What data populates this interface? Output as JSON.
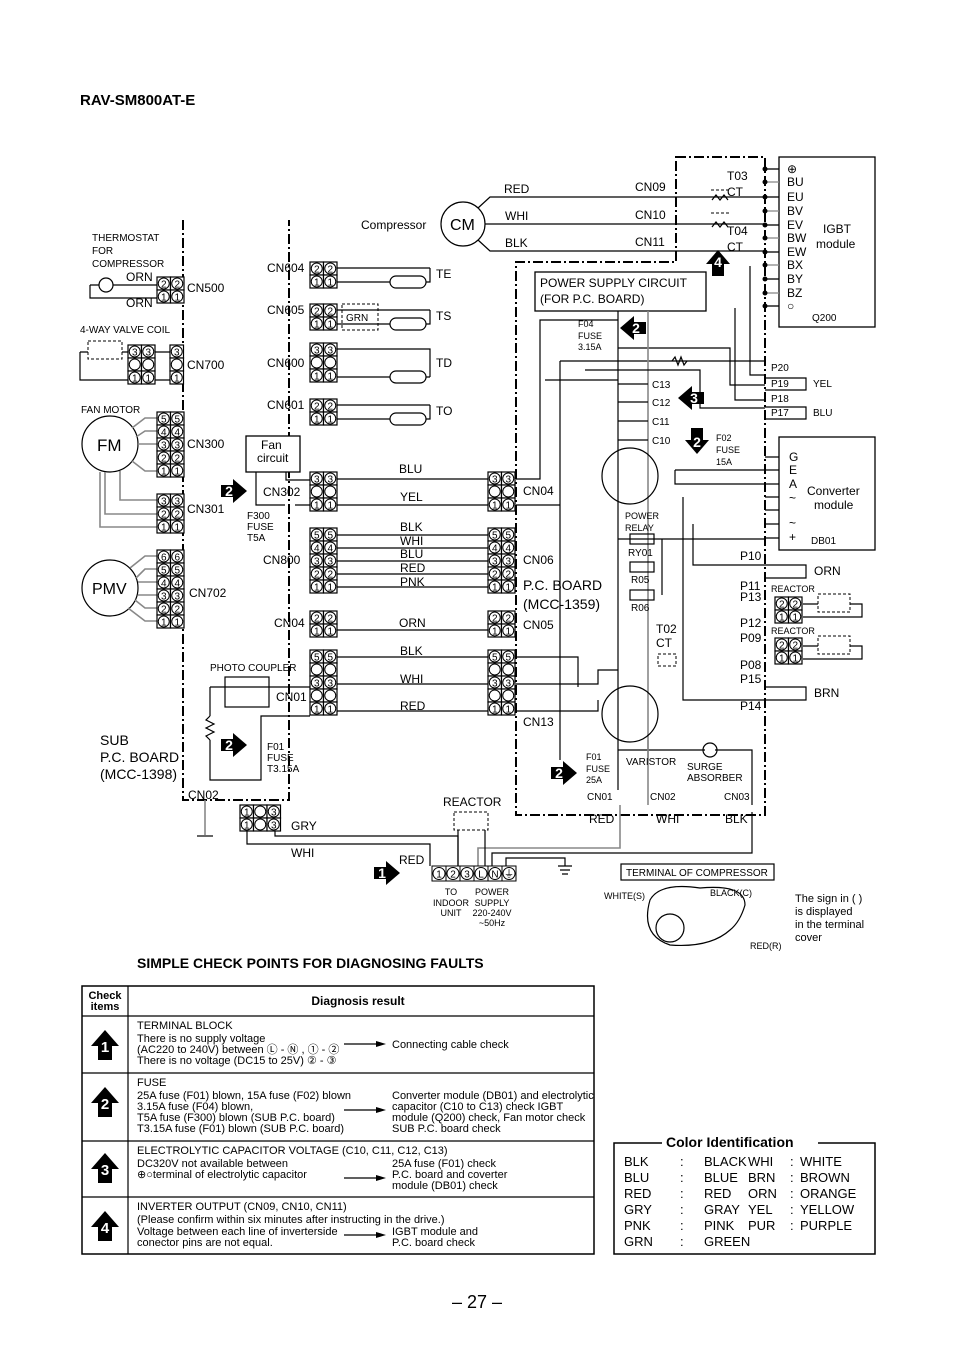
{
  "title": "RAV-SM800AT-E",
  "page_number": "– 27 –",
  "markers": {
    "one": "1",
    "two": "2",
    "three": "3",
    "four": "4"
  },
  "diagram": {
    "compressor": "Compressor",
    "cm": "CM",
    "red": "RED",
    "whi": "WHI",
    "blk": "BLK",
    "blu": "BLU",
    "yel": "YEL",
    "orn": "ORN",
    "pnk": "PNK",
    "grn": "GRN",
    "gry": "GRY",
    "brn": "BRN",
    "cn09": "CN09",
    "cn10": "CN10",
    "cn11": "CN11",
    "t03": "T03",
    "t04": "T04",
    "ct": "CT",
    "t02": "T02",
    "igbt_pins": [
      "⊕",
      "BU",
      "EU",
      "BV",
      "EV",
      "BW",
      "EW",
      "BX",
      "BY",
      "BZ",
      "○"
    ],
    "igbt_title": "IGBT",
    "igbt_sub": "module",
    "q200": "Q200",
    "psc_line1": "POWER SUPPLY CIRCUIT",
    "psc_line2": "(FOR P.C. BOARD)",
    "f04": "F04",
    "fuse": "FUSE",
    "f04_rating": "3.15A",
    "p20": "P20",
    "p19": "P19",
    "p18": "P18",
    "p17": "P17",
    "c13": "C13",
    "c12": "C12",
    "c11": "C11",
    "c10": "C10",
    "f02": "F02",
    "f02_rating": "15A",
    "conv_pins": [
      "G",
      "E",
      "A",
      "~",
      "~",
      "+"
    ],
    "conv_title": "Converter",
    "conv_sub": "module",
    "db01": "DB01",
    "power_relay_1": "POWER",
    "power_relay_2": "RELAY",
    "ry01": "RY01",
    "r05": "R05",
    "r06": "R06",
    "p10": "P10",
    "p11": "P11",
    "p13": "P13",
    "p12": "P12",
    "p09": "P09",
    "p08": "P08",
    "p15": "P15",
    "p14": "P14",
    "reactor": "REACTOR",
    "pcb_line1": "P.C. BOARD",
    "pcb_line2": "(MCC-1359)",
    "cn04": "CN04",
    "cn06": "CN06",
    "cn05": "CN05",
    "cn13": "CN13",
    "f01": "F01",
    "f01_rating": "25A",
    "varistor": "VARISTOR",
    "surge_1": "SURGE",
    "surge_2": "ABSORBER",
    "cn01": "CN01",
    "cn02": "CN02",
    "cn03": "CN03",
    "cn604": "CN604",
    "cn605": "CN605",
    "cn600": "CN600",
    "cn601": "CN601",
    "cn302": "CN302",
    "cn800": "CN800",
    "te": "TE",
    "ts": "TS",
    "td": "TD",
    "to": "TO",
    "fan_circuit_1": "Fan",
    "fan_circuit_2": "circuit",
    "f300": "F300",
    "f300_rating": "T5A",
    "thermostat_1": "THERMOSTAT",
    "thermostat_2": "FOR",
    "thermostat_3": "COMPRESSOR",
    "cn500": "CN500",
    "valve_coil": "4-WAY VALVE COIL",
    "cn700": "CN700",
    "fan_motor": "FAN MOTOR",
    "fm": "FM",
    "cn300": "CN300",
    "cn301": "CN301",
    "pmv": "PMV",
    "cn702": "CN702",
    "photo_coupler": "PHOTO COUPLER",
    "sub_f01": "F01",
    "sub_f01_rating": "T3.15A",
    "sub_pcb_1": "SUB",
    "sub_pcb_2": "P.C. BOARD",
    "sub_pcb_3": "(MCC-1398)",
    "terminal_pins": [
      "1",
      "2",
      "3",
      "L",
      "N",
      "⏚"
    ],
    "to_indoor": [
      "TO",
      "INDOOR",
      "UNIT"
    ],
    "power_supply": [
      "POWER",
      "SUPPLY",
      "220-240V",
      "~50Hz"
    ],
    "terminal_of_compressor": "TERMINAL OF COMPRESSOR",
    "white_s": "WHITE(S)",
    "black_c": "BLACK(C)",
    "red_r": "RED(R)",
    "sign_note": [
      "The sign in ( )",
      "is displayed",
      "in the  terminal",
      "cover"
    ]
  },
  "connectors": {
    "CN604": [
      [
        "2",
        "2"
      ],
      [
        "1",
        "1"
      ]
    ],
    "CN605": [
      [
        "2",
        "2"
      ],
      [
        "1",
        "1"
      ]
    ],
    "CN600": [
      [
        "3",
        "3"
      ],
      [
        "",
        ""
      ],
      [
        "1",
        "1"
      ]
    ],
    "CN601": [
      [
        "2",
        "2"
      ],
      [
        "1",
        "1"
      ]
    ],
    "CN302": [
      [
        "3",
        "3"
      ],
      [
        "",
        ""
      ],
      [
        "1",
        "1"
      ]
    ],
    "CN800": [
      [
        "5",
        "5"
      ],
      [
        "4",
        "4"
      ],
      [
        "3",
        "3"
      ],
      [
        "2",
        "2"
      ],
      [
        "1",
        "1"
      ]
    ],
    "CN04S": [
      [
        "2",
        "2"
      ],
      [
        "1",
        "1"
      ]
    ],
    "CN01S": [
      [
        "5",
        "5"
      ],
      [
        "",
        ""
      ],
      [
        "3",
        "3"
      ],
      [
        "",
        ""
      ],
      [
        "1",
        "1"
      ]
    ],
    "CN500": [
      [
        "2",
        "2"
      ],
      [
        "1",
        "1"
      ]
    ],
    "CN700A": [
      [
        "3",
        "3"
      ],
      [
        "",
        ""
      ],
      [
        "1",
        "1"
      ]
    ],
    "CN700B": [
      [
        "3"
      ],
      [
        ""
      ],
      [
        "1"
      ]
    ],
    "CN300": [
      [
        "5",
        "5"
      ],
      [
        "4",
        "4"
      ],
      [
        "3",
        "3"
      ],
      [
        "2",
        "2"
      ],
      [
        "1",
        "1"
      ]
    ],
    "CN301": [
      [
        "3",
        "3"
      ],
      [
        "2",
        "2"
      ],
      [
        "1",
        "1"
      ]
    ],
    "CN702": [
      [
        "6",
        "6"
      ],
      [
        "5",
        "5"
      ],
      [
        "4",
        "4"
      ],
      [
        "3",
        "3"
      ],
      [
        "2",
        "2"
      ],
      [
        "1",
        "1"
      ]
    ],
    "CN04M": [
      [
        "3",
        "3"
      ],
      [
        "",
        ""
      ],
      [
        "1",
        "1"
      ]
    ],
    "CN06": [
      [
        "5",
        "5"
      ],
      [
        "4",
        "4"
      ],
      [
        "3",
        "3"
      ],
      [
        "2",
        "2"
      ],
      [
        "1",
        "1"
      ]
    ],
    "CN05": [
      [
        "2",
        "2"
      ],
      [
        "1",
        "1"
      ]
    ],
    "CN13": [
      [
        "5",
        "5"
      ],
      [
        "",
        ""
      ],
      [
        "3",
        "3"
      ],
      [
        "",
        ""
      ],
      [
        "1",
        "1"
      ]
    ],
    "CN02S": [
      [
        "1",
        "",
        "3"
      ],
      [
        "1",
        "",
        "3"
      ]
    ],
    "REACT1": [
      [
        "2",
        "2"
      ],
      [
        "1",
        "1"
      ]
    ],
    "REACT2": [
      [
        "2",
        "2"
      ],
      [
        "1",
        "1"
      ]
    ]
  },
  "section_title": "SIMPLE CHECK POINTS FOR DIAGNOSING FAULTS",
  "table": {
    "header_check": [
      "Check",
      "items"
    ],
    "header_result": "Diagnosis result",
    "rows": [
      {
        "marker": "1",
        "heading": "TERMINAL BLOCK",
        "left": [
          "There is no supply voltage",
          "(AC220 to 240V) between Ⓛ - Ⓝ , ① - ②",
          "There is no voltage (DC15 to 25V) ② - ③"
        ],
        "right": [
          "Connecting cable check"
        ]
      },
      {
        "marker": "2",
        "heading": "FUSE",
        "left": [
          "25A fuse (F01) blown, 15A fuse (F02) blown",
          "3.15A fuse (F04) blown,",
          "T5A fuse (F300) blown (SUB P.C. board)",
          "T3.15A fuse (F01) blown (SUB P.C. board)"
        ],
        "right": [
          "Converter module (DB01) and electrolytic",
          "capacitor (C10 to C13) check  IGBT",
          "module (Q200) check, Fan motor check",
          "SUB P.C. board check"
        ]
      },
      {
        "marker": "3",
        "heading": "ELECTROLYTIC CAPACITOR VOLTAGE (C10, C11, C12, C13)",
        "left": [
          "DC320V not available between",
          "⊕○terminal of electrolytic capacitor"
        ],
        "right": [
          "25A fuse (F01) check",
          "P.C. board and coverter",
          "module (DB01) check"
        ]
      },
      {
        "marker": "4",
        "heading": "INVERTER OUTPUT (CN09, CN10, CN11)",
        "note": "(Please confirm within six minutes after instructing in the drive.)",
        "left": [
          "Voltage between each line of inverterside",
          "conector pins are not equal."
        ],
        "right": [
          "IGBT module and",
          "P.C. board check"
        ]
      }
    ]
  },
  "color_identification": {
    "title": "Color Identification",
    "left": [
      [
        "BLK",
        ":",
        "BLACK"
      ],
      [
        "BLU",
        ":",
        "BLUE"
      ],
      [
        "RED",
        ":",
        "RED"
      ],
      [
        "GRY",
        ":",
        "GRAY"
      ],
      [
        "PNK",
        ":",
        "PINK"
      ],
      [
        "GRN",
        ":",
        "GREEN"
      ]
    ],
    "right": [
      [
        "WHI",
        ":",
        "WHITE"
      ],
      [
        "BRN",
        ":",
        "BROWN"
      ],
      [
        "ORN",
        ":",
        "ORANGE"
      ],
      [
        "YEL",
        ":",
        "YELLOW"
      ],
      [
        "PUR",
        ":",
        "PURPLE"
      ]
    ]
  }
}
